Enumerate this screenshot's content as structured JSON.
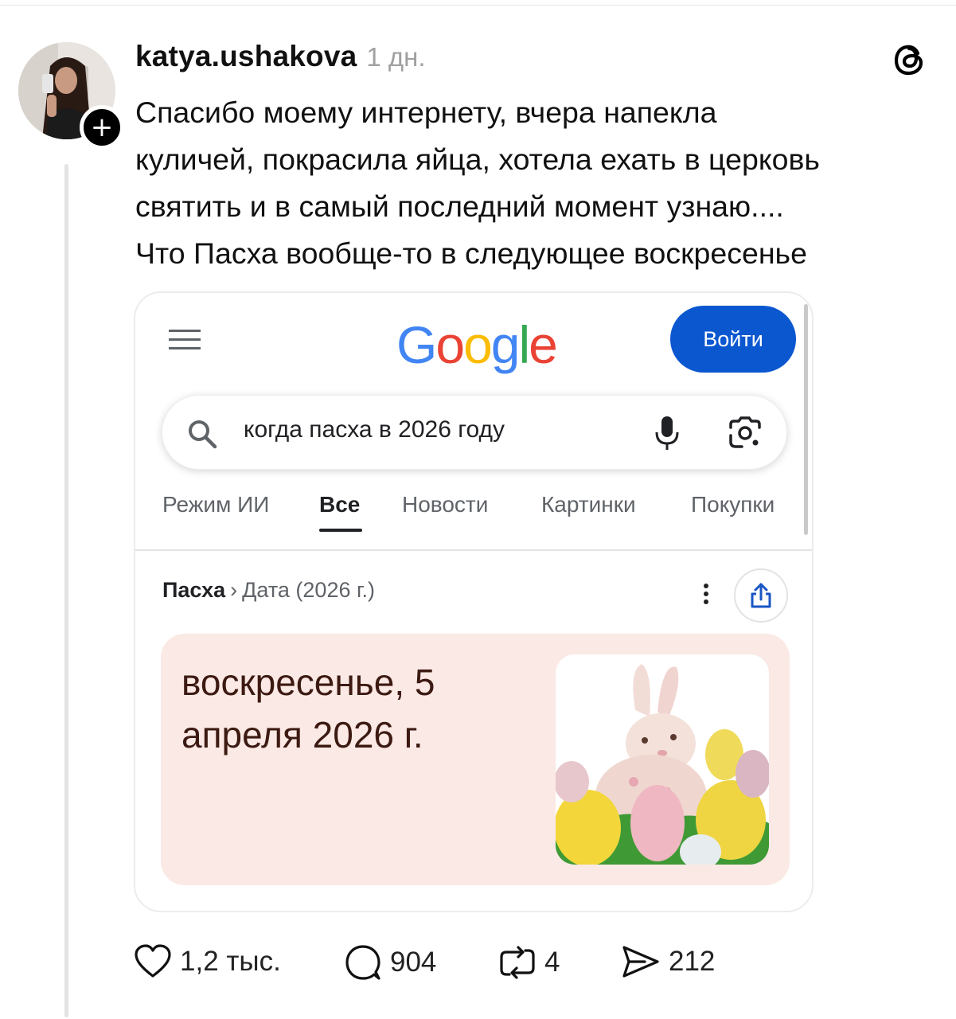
{
  "post": {
    "username": "katya.ushakova",
    "time": "1 дн.",
    "follow_symbol": "+",
    "text_lines": [
      "Спасибо моему интернету, вчера напекла",
      "куличей, покрасила яйца, хотела ехать в церковь",
      "святить и в самый последний момент узнаю....",
      "Что Пасха вообще-то в следующее воскресенье"
    ]
  },
  "google": {
    "signin_label": "Войти",
    "search_query": "когда пасха в 2026 году",
    "tabs": [
      "Режим ИИ",
      "Все",
      "Новости",
      "Картинки",
      "Покупки"
    ],
    "active_tab": "Все",
    "breadcrumb": {
      "root": "Пасха",
      "separator": "›",
      "child": "Дата (2026 г.)"
    },
    "answer_lines": [
      "воскресенье, 5",
      "апреля 2026 г."
    ],
    "logo_colors": {
      "blue": "#4285F4",
      "red": "#EA4335",
      "yellow": "#FBBC05",
      "green": "#34A853"
    },
    "signin_color": "#0b57d0"
  },
  "actions": {
    "likes": "1,2 тыс.",
    "comments": "904",
    "reposts": "4",
    "shares": "212"
  },
  "icons": [
    "threads-logo-icon",
    "menu-icon",
    "search-icon",
    "microphone-icon",
    "google-lens-icon",
    "more-vertical-icon",
    "share-icon",
    "heart-icon",
    "comment-icon",
    "repost-icon",
    "send-icon"
  ]
}
